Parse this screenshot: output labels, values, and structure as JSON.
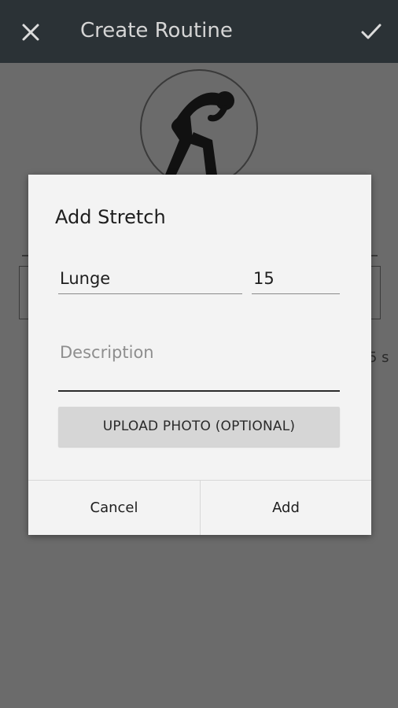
{
  "app_bar": {
    "title": "Create Routine",
    "close_icon": "close-icon",
    "confirm_icon": "check-icon"
  },
  "background": {
    "routine_icon": "stretching-person-icon",
    "partial_text_right": "5 s"
  },
  "dialog": {
    "title": "Add Stretch",
    "name_value": "Lunge",
    "duration_value": "15",
    "description_placeholder": "Description",
    "upload_label": "UPLOAD PHOTO (OPTIONAL)",
    "cancel_label": "Cancel",
    "add_label": "Add"
  }
}
